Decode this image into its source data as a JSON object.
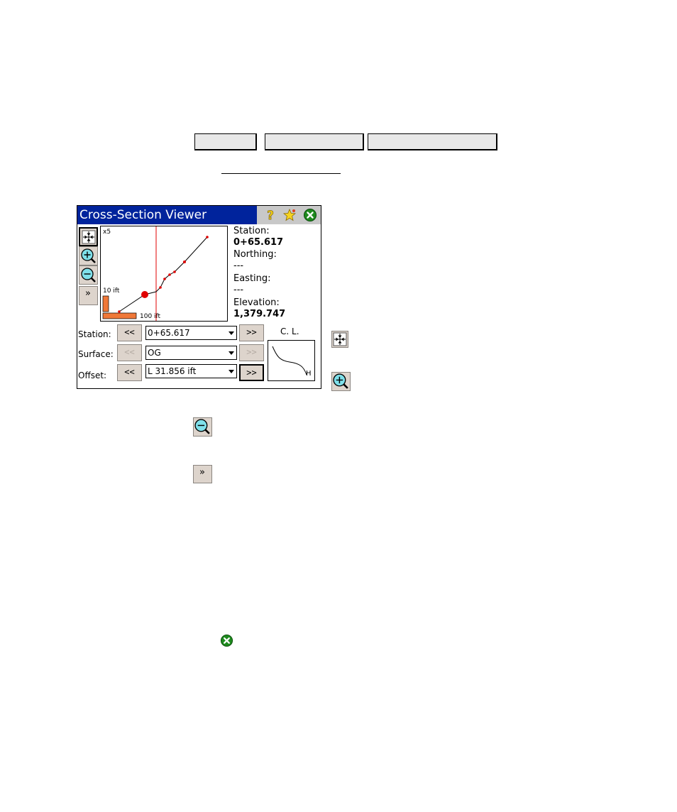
{
  "nav": {
    "buttons": [
      "",
      "",
      ""
    ]
  },
  "window": {
    "title": "Cross-Section Viewer",
    "icons": [
      "help-icon",
      "favorite-star-icon",
      "close-icon"
    ],
    "plot": {
      "exaggeration": "x5",
      "vscale": "10 ift",
      "hscale": "100 ift"
    },
    "info": {
      "station_label": "Station:",
      "station_value": "0+65.617",
      "northing_label": "Northing:",
      "northing_value": "---",
      "easting_label": "Easting:",
      "easting_value": "---",
      "elevation_label": "Elevation:",
      "elevation_value": "1,379.747"
    },
    "controls": {
      "station": {
        "label": "Station:",
        "prev": "<<",
        "value": "0+65.617",
        "next": ">>"
      },
      "surface": {
        "label": "Surface:",
        "prev": "<<",
        "value": "OG",
        "next": ">>"
      },
      "offset": {
        "label": "Offset:",
        "prev": "<<",
        "value": "L 31.856 ift",
        "next": ">>"
      }
    },
    "centerline": {
      "label": "C. L.",
      "marker": "H"
    },
    "side_buttons": [
      "zoom-extents-icon",
      "zoom-in-icon",
      "zoom-out-icon",
      "expand-icon"
    ]
  },
  "legend_icons": {
    "expand_glyph": "»"
  },
  "colors": {
    "titlebar": "#00239c",
    "button_face": "#ddd4cc",
    "plot_point": "#e00000",
    "scale_bar": "#f07838",
    "close_green": "#1e8a1e"
  }
}
